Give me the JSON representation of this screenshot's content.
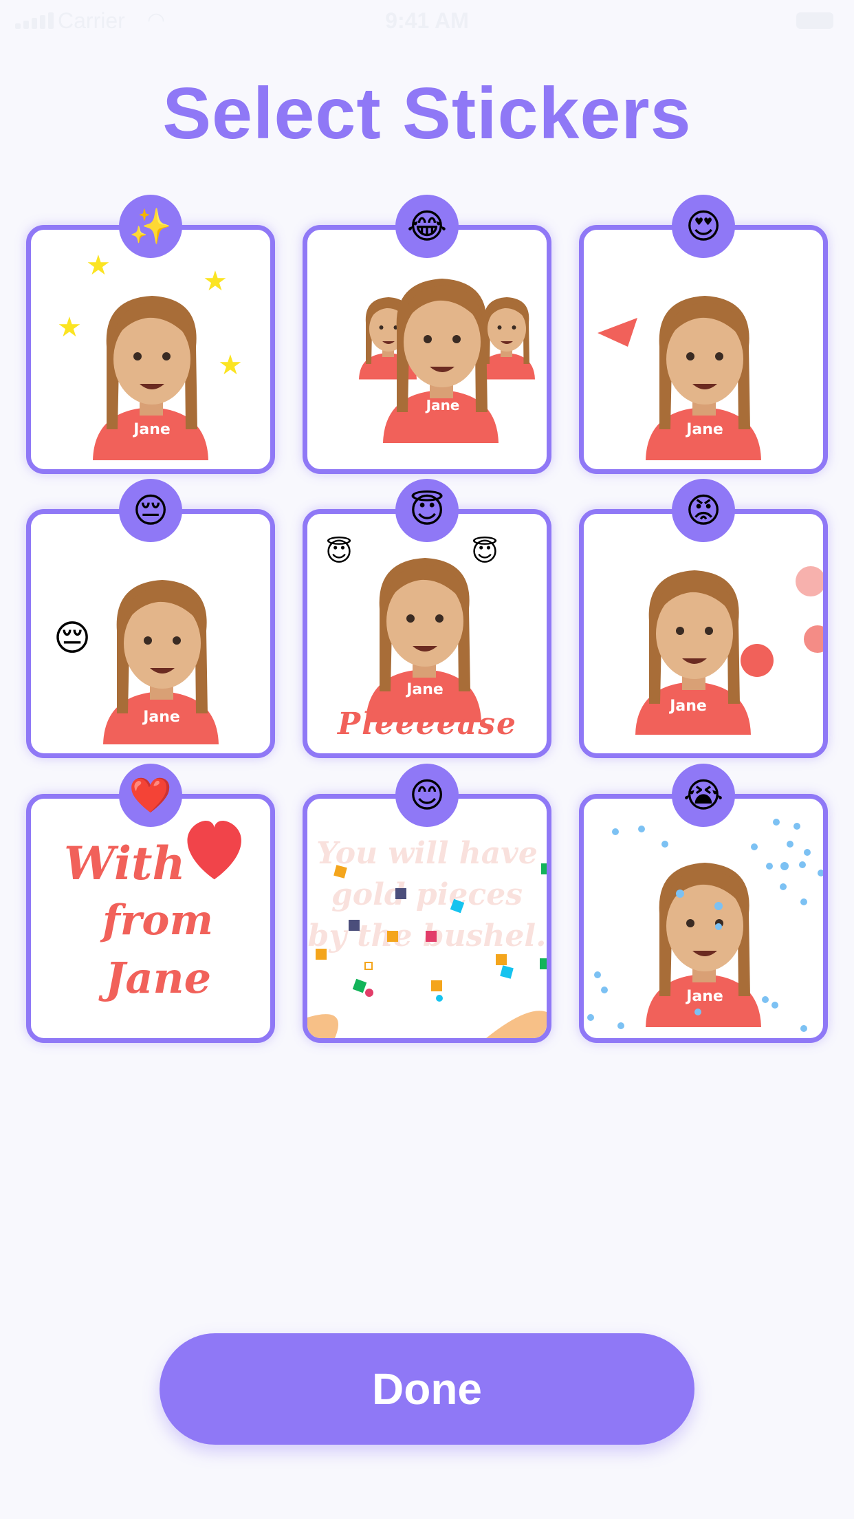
{
  "status_bar": {
    "carrier": "Carrier",
    "time": "9:41 AM"
  },
  "title": "Select Stickers",
  "stickers": [
    {
      "badge_emoji": "✨",
      "name_tag": "Jane"
    },
    {
      "badge_emoji": "😂",
      "name_tag": "Jane"
    },
    {
      "badge_emoji": "😍",
      "name_tag": "Jane"
    },
    {
      "badge_emoji": "😔",
      "name_tag": "Jane",
      "side_emoji": "😔"
    },
    {
      "badge_emoji": "😇",
      "name_tag": "Jane",
      "side_emoji": "😇",
      "caption": "Pleeeease"
    },
    {
      "badge_emoji": "😡",
      "name_tag": "Jane",
      "side_emoji": "😡"
    },
    {
      "badge_emoji": "❤️",
      "line1": "With",
      "line2": "from",
      "line3": "Jane"
    },
    {
      "badge_emoji": "😊",
      "caption": "You will have gold pieces by the bushel."
    },
    {
      "badge_emoji": "😭",
      "name_tag": "Jane"
    }
  ],
  "done_button": "Done",
  "colors": {
    "accent": "#8f78f6",
    "shirt": "#f1615a",
    "hair": "#a86d38",
    "skin": "#e3b58a"
  }
}
